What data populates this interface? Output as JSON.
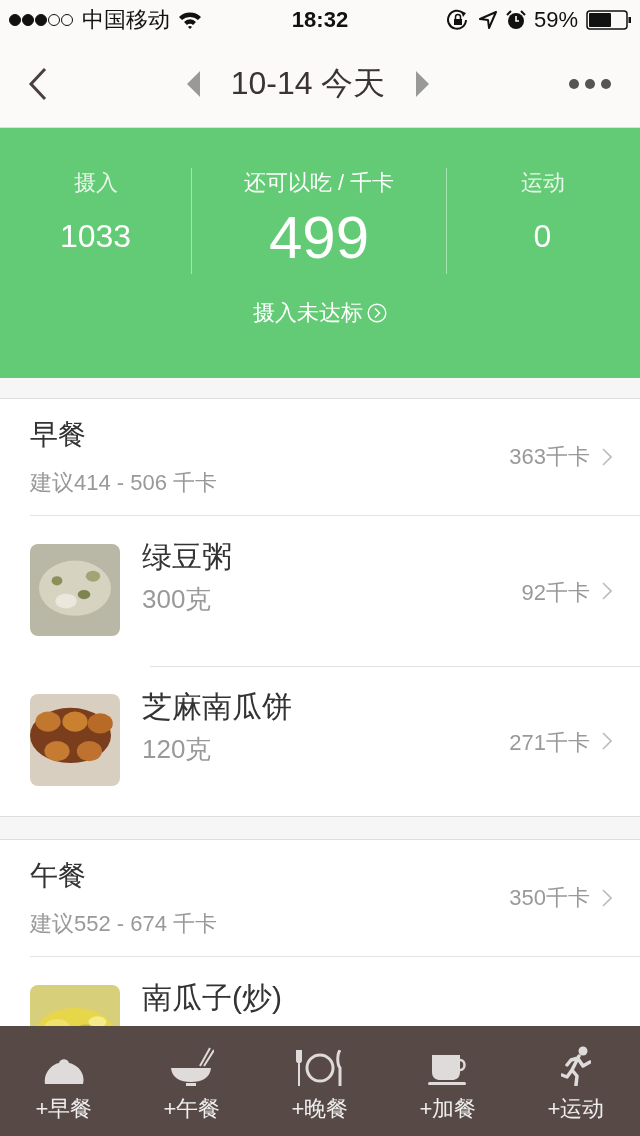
{
  "status_bar": {
    "carrier": "中国移动",
    "time": "18:32",
    "battery": "59%"
  },
  "nav": {
    "date": "10-14 今天"
  },
  "summary": {
    "intake_label": "摄入",
    "intake": "1033",
    "remaining_label": "还可以吃 / 千卡",
    "remaining": "499",
    "exercise_label": "运动",
    "exercise": "0",
    "notice": "摄入未达标"
  },
  "meals": [
    {
      "name": "早餐",
      "suggestion": "建议414 - 506 千卡",
      "kcal": "363千卡",
      "foods": [
        {
          "name": "绿豆粥",
          "amount": "300克",
          "kcal": "92千卡"
        },
        {
          "name": "芝麻南瓜饼",
          "amount": "120克",
          "kcal": "271千卡"
        }
      ]
    },
    {
      "name": "午餐",
      "suggestion": "建议552 - 674 千卡",
      "kcal": "350千卡",
      "foods": [
        {
          "name": "南瓜子(炒)"
        }
      ]
    }
  ],
  "tab_bar": [
    "+早餐",
    "+午餐",
    "+晚餐",
    "+加餐",
    "+运动"
  ]
}
